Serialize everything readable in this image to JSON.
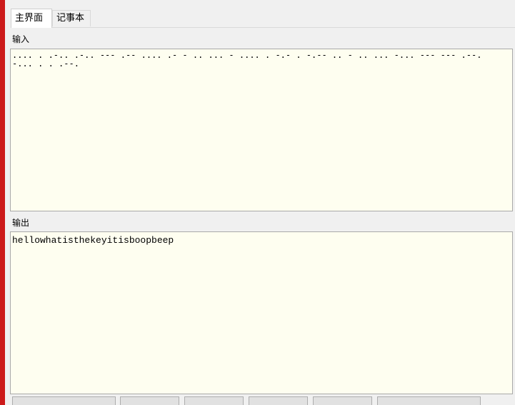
{
  "tabs": [
    {
      "label": "主界面",
      "active": true
    },
    {
      "label": "记事本",
      "active": false
    }
  ],
  "input": {
    "label": "输入",
    "value": ".... . .-.. .-.. --- .-- .... .- - .. ... - .... . -.- . -.-- .. - .. ... -... --- --- .--. -... . . .--."
  },
  "output": {
    "label": "输出",
    "value": "hellowhatisthekeyitisboopbeep"
  },
  "icons": {
    "scroll_up": "chevron-up-icon",
    "scroll_down": "chevron-down-icon"
  },
  "colors": {
    "text_area_bg": "#fefef0",
    "window_bg": "#f0f0f0",
    "outer_bg": "#cc1a1a"
  }
}
